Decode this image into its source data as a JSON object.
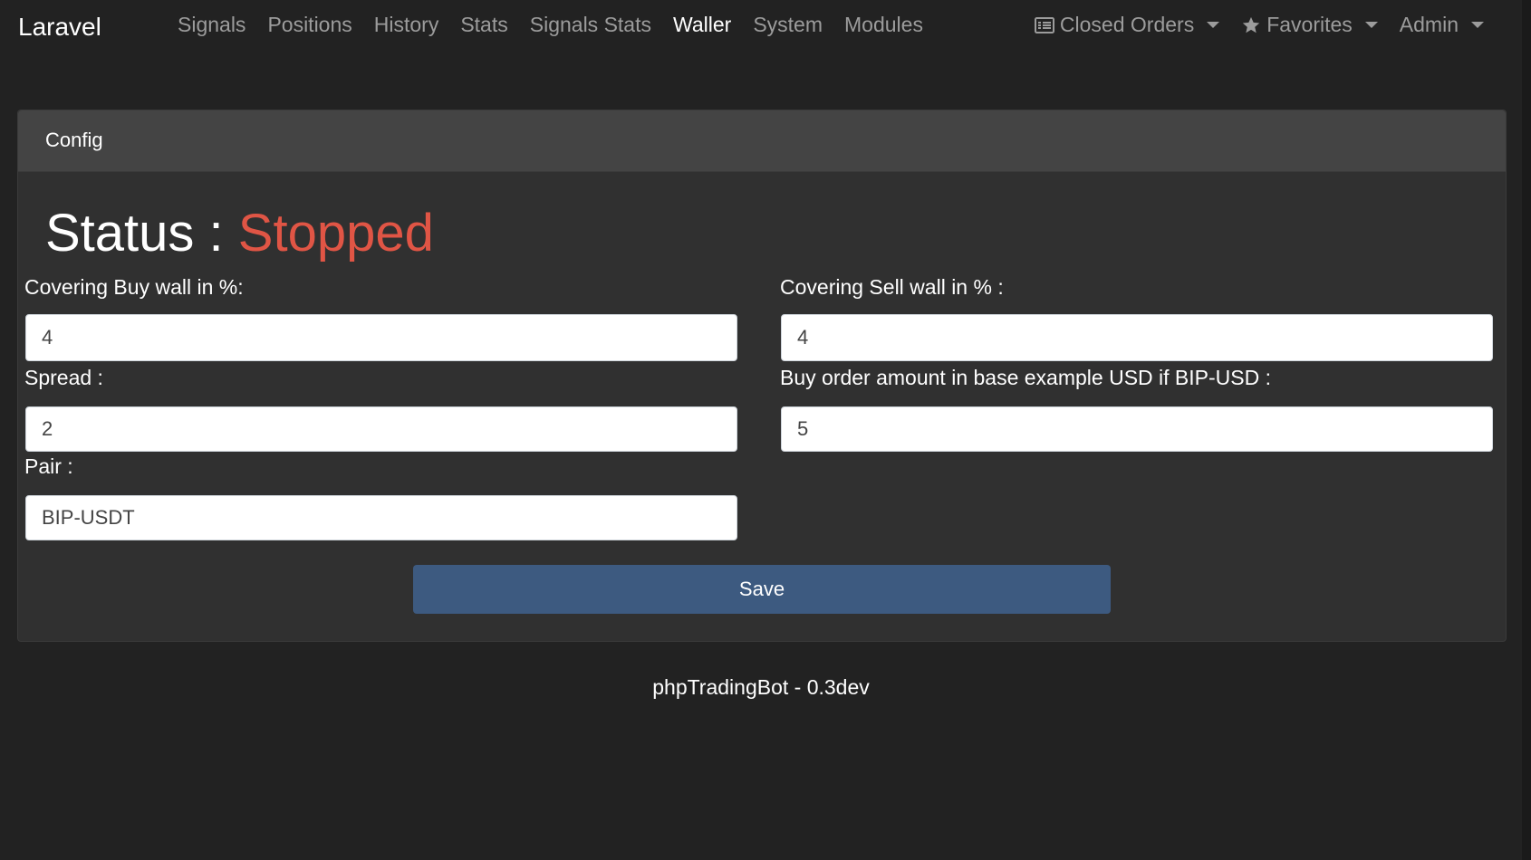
{
  "navbar": {
    "brand": "Laravel",
    "links": [
      {
        "label": "Signals"
      },
      {
        "label": "Positions"
      },
      {
        "label": "History"
      },
      {
        "label": "Stats"
      },
      {
        "label": "Signals Stats"
      },
      {
        "label": "Waller",
        "active": true
      },
      {
        "label": "System"
      },
      {
        "label": "Modules"
      }
    ],
    "right": {
      "closed_orders": {
        "label": "Closed Orders",
        "icon": "list-icon"
      },
      "favorites": {
        "label": "Favorites",
        "icon": "star-icon"
      },
      "admin": {
        "label": "Admin"
      }
    }
  },
  "card": {
    "header": "Config",
    "status_label": "Status :",
    "status_value": "Stopped",
    "status_color": "#e05545",
    "fields": {
      "buy_wall": {
        "label": "Covering Buy wall in %:",
        "value": "4"
      },
      "sell_wall": {
        "label": "Covering Sell wall in % :",
        "value": "4"
      },
      "spread": {
        "label": "Spread :",
        "value": "2"
      },
      "buy_amount": {
        "label": "Buy order amount in base example USD if BIP-USD :",
        "value": "5"
      },
      "pair": {
        "label": "Pair :",
        "value": "BIP-USDT"
      }
    },
    "save_label": "Save"
  },
  "footer": {
    "text": "phpTradingBot - 0.3dev"
  },
  "colors": {
    "background": "#222222",
    "card": "#303030",
    "card_header": "#444444",
    "button": "#3d5a80"
  }
}
